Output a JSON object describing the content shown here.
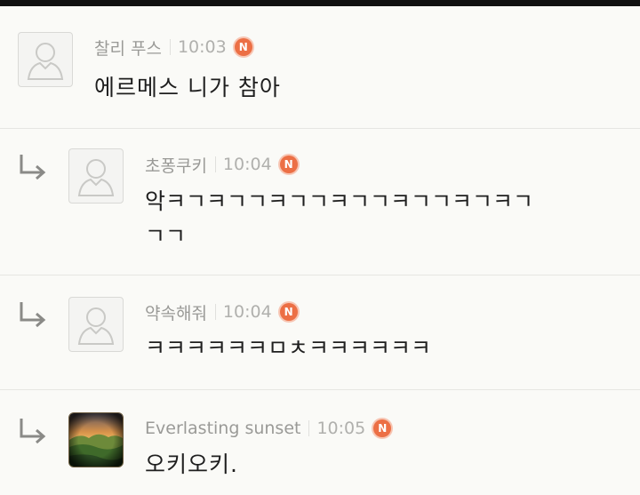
{
  "comments": [
    {
      "author": "찰리 푸스",
      "time": "10:03",
      "badge": "N",
      "text": "에르메스 니가 참아",
      "is_reply": false,
      "avatar": "default-user-icon"
    },
    {
      "author": "초퐁쿠키",
      "time": "10:04",
      "badge": "N",
      "text_line1": "악ㅋㄱㅋㄱㄱㅋㄱㄱㅋㄱㄱㅋㄱㄱㅋㄱㅋㄱ",
      "text_line2": "ㄱㄱ",
      "is_reply": true,
      "avatar": "default-user-icon"
    },
    {
      "author": "약속해줘",
      "time": "10:04",
      "badge": "N",
      "text": "ㅋㅋㅋㅋㅋㅋㅁㅊㅋㅋㅋㅋㅋㅋ",
      "is_reply": true,
      "avatar": "default-user-icon"
    },
    {
      "author": "Everlasting sunset",
      "time": "10:05",
      "badge": "N",
      "text": "오키오키.",
      "is_reply": true,
      "avatar": "sunset-photo"
    }
  ],
  "colors": {
    "badge": "#ec6f45",
    "author": "#9a9a97",
    "time": "#b0b0ad",
    "text": "#1e1e1e",
    "background": "#fafaf7"
  }
}
